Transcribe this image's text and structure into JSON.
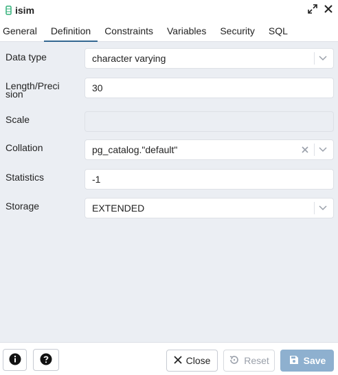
{
  "window": {
    "title": "isim"
  },
  "tabs": [
    {
      "label": "General"
    },
    {
      "label": "Definition"
    },
    {
      "label": "Constraints"
    },
    {
      "label": "Variables"
    },
    {
      "label": "Security"
    },
    {
      "label": "SQL"
    }
  ],
  "active_tab": "Definition",
  "form": {
    "data_type": {
      "label": "Data type",
      "value": "character varying"
    },
    "length": {
      "label_line1": "Length/Preci",
      "label_line2": "sion",
      "value": "30"
    },
    "scale": {
      "label": "Scale",
      "value": ""
    },
    "collation": {
      "label": "Collation",
      "value": "pg_catalog.\"default\""
    },
    "statistics": {
      "label": "Statistics",
      "value": "-1"
    },
    "storage": {
      "label": "Storage",
      "value": "EXTENDED"
    }
  },
  "footer": {
    "close_label": "Close",
    "reset_label": "Reset",
    "save_label": "Save"
  },
  "colors": {
    "accent": "#326690",
    "save_button": "#8eb0cf",
    "panel_bg": "#ebeef3",
    "column_icon": "#33b07a"
  },
  "icons": {
    "title": "column-icon",
    "expand": "expand-icon",
    "close": "close-icon",
    "info": "info-icon",
    "help": "help-icon",
    "reset": "reset-icon",
    "save": "save-icon",
    "dropdown": "chevron-down-icon",
    "clear": "clear-icon"
  }
}
